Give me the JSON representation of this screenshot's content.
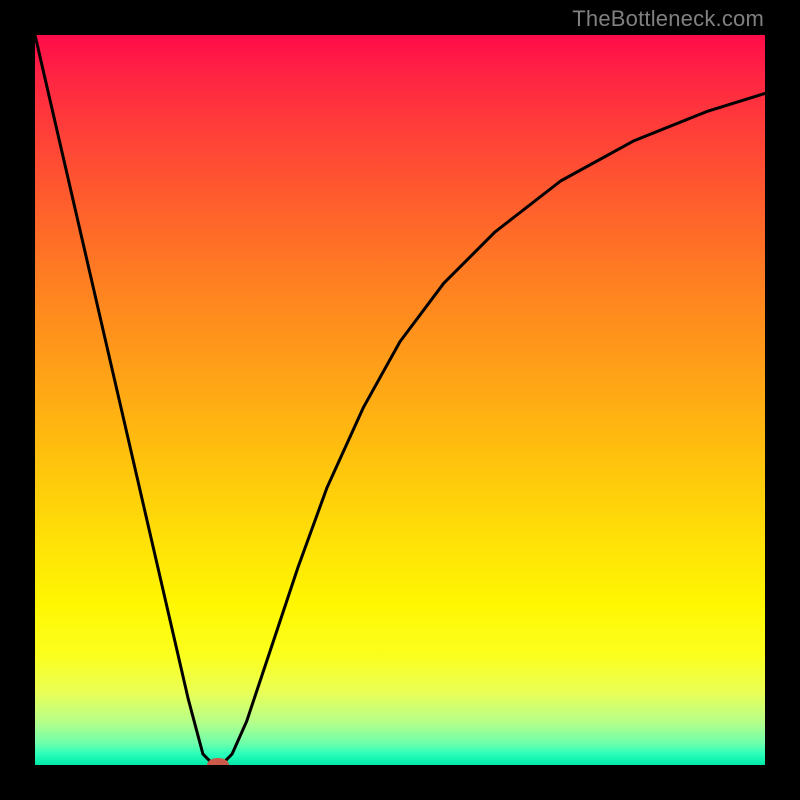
{
  "watermark": {
    "text": "TheBottleneck.com"
  },
  "chart_data": {
    "type": "line",
    "title": "",
    "xlabel": "",
    "ylabel": "",
    "xlim": [
      0,
      100
    ],
    "ylim": [
      0,
      100
    ],
    "grid": false,
    "background": "vertical-gradient red→orange→yellow→green",
    "series": [
      {
        "name": "bottleneck-curve",
        "x": [
          0,
          3,
          6,
          9,
          12,
          15,
          18,
          21,
          23,
          24,
          25,
          26,
          27,
          29,
          31,
          33,
          36,
          40,
          45,
          50,
          56,
          63,
          72,
          82,
          92,
          100
        ],
        "values": [
          100,
          87,
          74,
          61,
          48,
          35,
          22,
          9,
          1.5,
          0.5,
          0,
          0.5,
          1.5,
          6,
          12,
          18,
          27,
          38,
          49,
          58,
          66,
          73,
          80,
          85.5,
          89.5,
          92
        ]
      }
    ],
    "marker": {
      "x": 25,
      "y": 0,
      "color": "#cb5a4a"
    }
  },
  "colors": {
    "frame": "#000000",
    "curve": "#000000",
    "marker": "#cb5a4a",
    "watermark": "#808080"
  }
}
